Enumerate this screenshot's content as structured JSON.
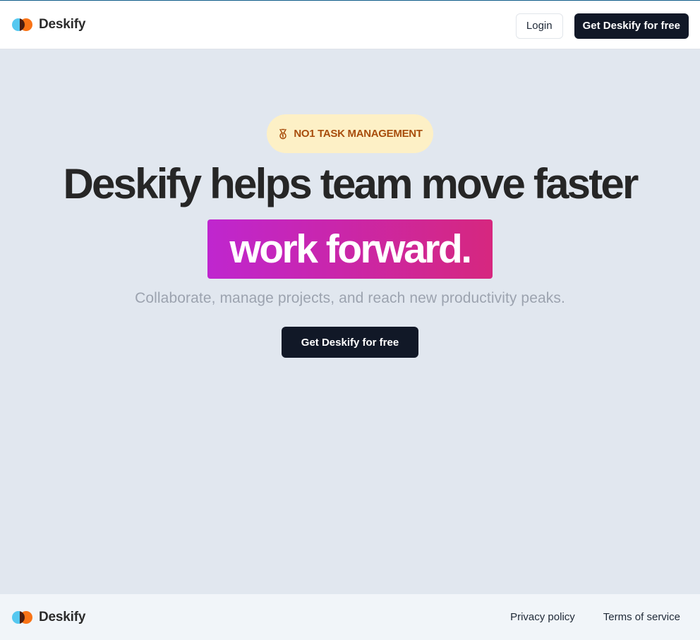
{
  "header": {
    "brand": "Deskify",
    "login_label": "Login",
    "cta_label": "Get Deskify for free"
  },
  "hero": {
    "badge_text": "NO1 TASK MANAGEMENT",
    "title": "Deskify helps team move faster",
    "highlight": "work forward.",
    "subtitle": "Collaborate, manage projects, and reach new productivity peaks.",
    "cta_label": "Get Deskify for free"
  },
  "footer": {
    "brand": "Deskify",
    "links": [
      "Privacy policy",
      "Terms of service"
    ]
  },
  "icons": {
    "logo": "deskify-logo-icon",
    "badge": "medal-icon"
  },
  "colors": {
    "cta_bg": "#111827",
    "badge_bg": "#fdf0c6",
    "badge_text": "#a84d0c",
    "highlight_start": "#bf26cf",
    "highlight_end": "#d6277f",
    "page_bg": "#e1e7ef"
  }
}
